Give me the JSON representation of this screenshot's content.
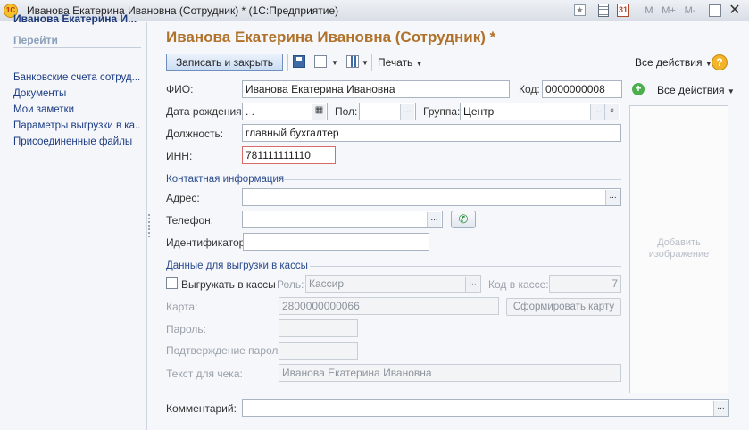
{
  "window": {
    "title": "Иванова Екатерина Ивановна (Сотрудник) *  (1С:Предприятие)",
    "logo_text": "1С",
    "toolbar_buttons": [
      "M",
      "M+",
      "M-"
    ]
  },
  "nav": {
    "header": "Иванова Екатерина И...",
    "goto_label": "Перейти",
    "items": [
      "Банковские счета сотруд...",
      "Документы",
      "Мои заметки",
      "Параметры выгрузки в ка...",
      "Присоединенные файлы"
    ]
  },
  "form": {
    "title": "Иванова Екатерина Ивановна (Сотрудник) *",
    "toolbar": {
      "save_close": "Записать и закрыть",
      "print": "Печать",
      "all_actions": "Все действия",
      "help": "?"
    },
    "fio_label": "ФИО:",
    "fio_value": "Иванова Екатерина Ивановна",
    "code_label": "Код:",
    "code_value": "0000000008",
    "birth_label": "Дата рождения:",
    "birth_value": " .  .",
    "gender_label": "Пол:",
    "gender_value": "",
    "group_label": "Группа:",
    "group_value": "Центр",
    "position_label": "Должность:",
    "position_value": "главный бухгалтер",
    "inn_label": "ИНН:",
    "inn_value": "781111111110",
    "contact_section": "Контактная информация",
    "address_label": "Адрес:",
    "address_value": "",
    "phone_label": "Телефон:",
    "phone_value": "",
    "ident_label": "Идентификатор:",
    "ident_value": "",
    "kassa_section": "Данные для выгрузки в кассы",
    "export_checkbox_label": "Выгружать в кассы",
    "export_checked": false,
    "role_label": "Роль:",
    "role_value": "Кассир",
    "kassa_code_label": "Код в кассе:",
    "kassa_code_value": "7",
    "card_label": "Карта:",
    "card_value": "2800000000066",
    "card_button": "Сформировать карту",
    "password_label": "Пароль:",
    "password_value": "",
    "password_confirm_label": "Подтверждение пароля:",
    "password_confirm_value": "",
    "receipt_label": "Текст для чека:",
    "receipt_value": "Иванова Екатерина Ивановна",
    "comment_label": "Комментарий:",
    "comment_value": ""
  },
  "photo": {
    "all_actions": "Все действия",
    "add_image_text": "Добавить изображение"
  },
  "colors": {
    "title_accent": "#b0722a",
    "link": "#1c3c85",
    "section": "#2a4b8d"
  }
}
